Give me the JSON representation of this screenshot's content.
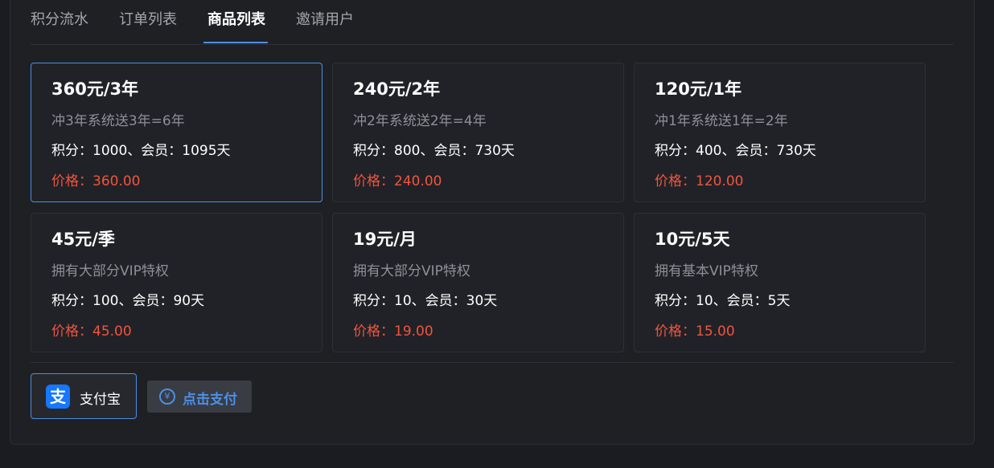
{
  "tabs": [
    {
      "label": "积分流水"
    },
    {
      "label": "订单列表"
    },
    {
      "label": "商品列表"
    },
    {
      "label": "邀请用户"
    }
  ],
  "products": [
    {
      "title": "360元/3年",
      "desc": "冲3年系统送3年=6年",
      "info": "积分：1000、会员：1095天",
      "price": "价格：360.00"
    },
    {
      "title": "240元/2年",
      "desc": "冲2年系统送2年=4年",
      "info": "积分：800、会员：730天",
      "price": "价格：240.00"
    },
    {
      "title": "120元/1年",
      "desc": "冲1年系统送1年=2年",
      "info": "积分：400、会员：730天",
      "price": "价格：120.00"
    },
    {
      "title": "45元/季",
      "desc": "拥有大部分VIP特权",
      "info": "积分：100、会员：90天",
      "price": "价格：45.00"
    },
    {
      "title": "19元/月",
      "desc": "拥有大部分VIP特权",
      "info": "积分：10、会员：30天",
      "price": "价格：19.00"
    },
    {
      "title": "10元/5天",
      "desc": "拥有基本VIP特权",
      "info": "积分：10、会员：5天",
      "price": "价格：15.00"
    }
  ],
  "payment": {
    "method_label": "支付宝",
    "method_icon": "alipay-icon",
    "pay_button_label": "点击支付",
    "pay_button_icon": "yen-circle-icon"
  },
  "colors": {
    "accent": "#4c8fe8",
    "price": "#f0553f",
    "background": "#1f2024"
  }
}
